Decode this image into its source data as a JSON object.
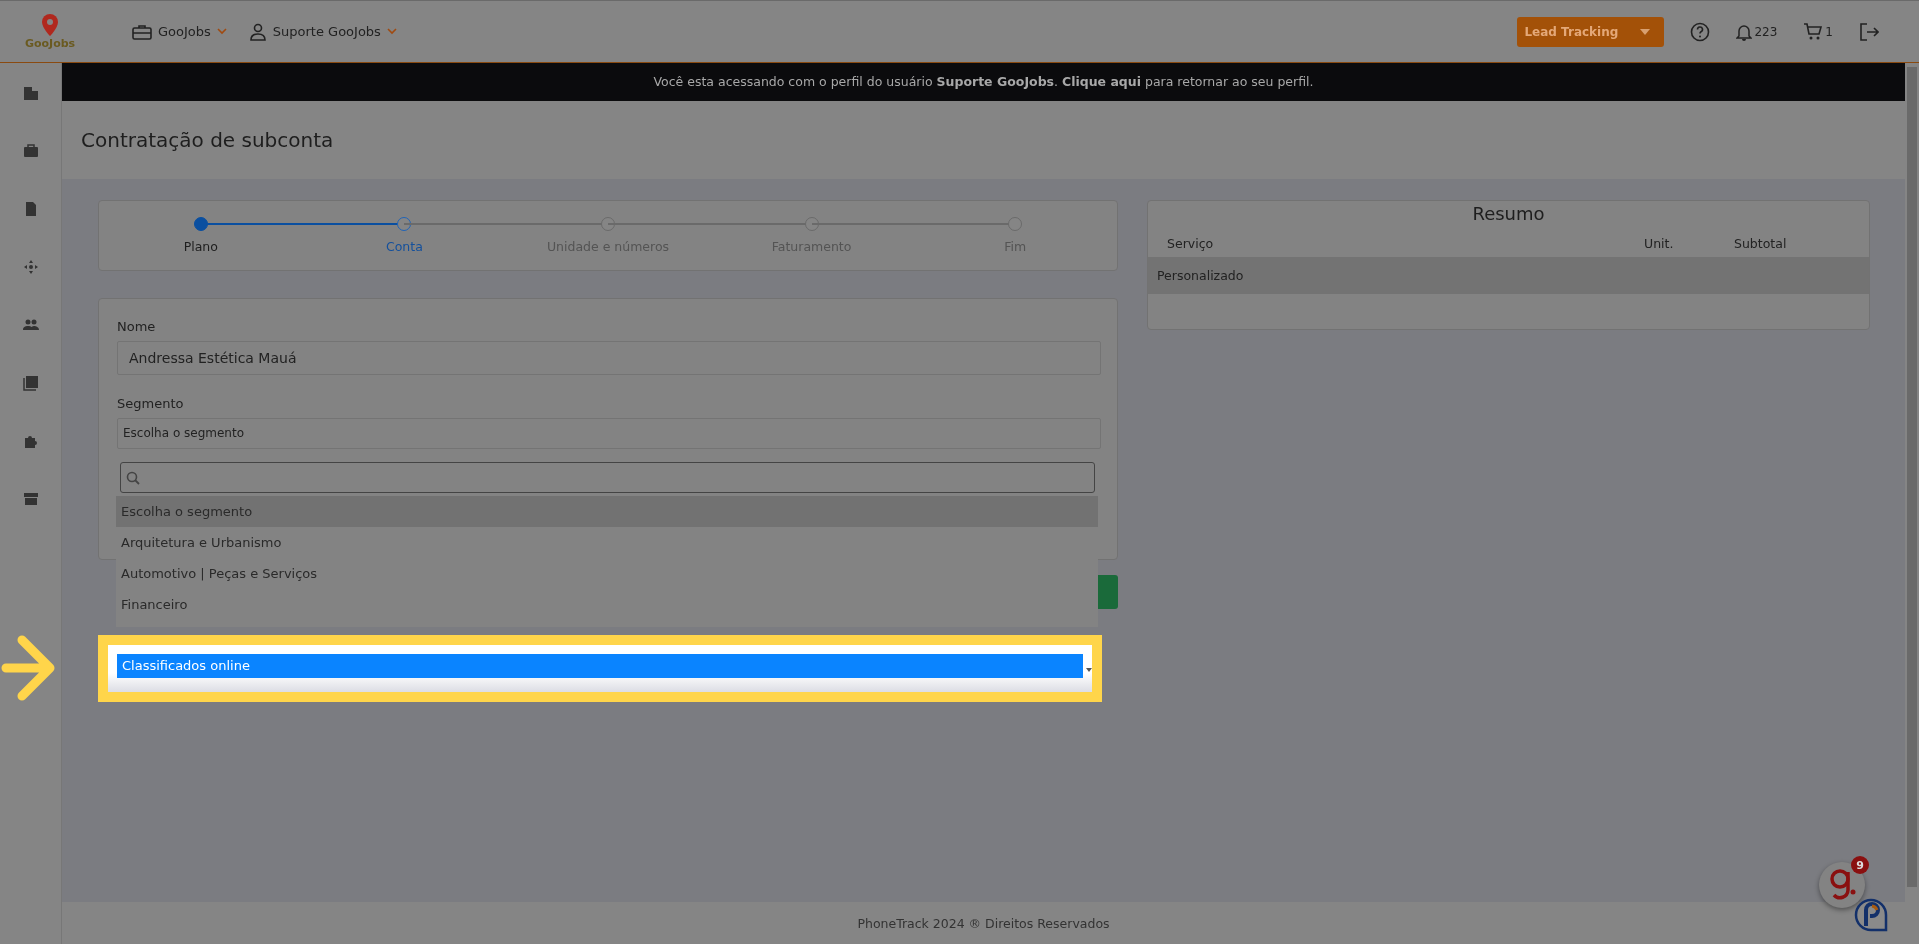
{
  "header": {
    "logo": "GooJobs",
    "menus": [
      {
        "label": "GooJobs"
      },
      {
        "label": "Suporte GooJobs"
      }
    ],
    "lead_button": "Lead Tracking",
    "notifications": "223",
    "cart": "1"
  },
  "banner": {
    "text": "Você esta acessando com o perfil do usuário **Suporte GooJobs**.",
    "link": "Clique aqui",
    "after": "para retornar ao seu perfil."
  },
  "page_title": "Contratação de subconta",
  "steps": [
    {
      "label": "Plano",
      "completed": true,
      "selected": false
    },
    {
      "label": "Conta",
      "completed": false,
      "selected": true
    },
    {
      "label": "Unidade e números",
      "completed": false,
      "selected": false
    },
    {
      "label": "Faturamento",
      "completed": false,
      "selected": false
    },
    {
      "label": "Fim",
      "completed": false,
      "selected": false
    }
  ],
  "form": {
    "name_label": "Nome",
    "name_value": "Andressa Estética Mauá",
    "segment_label": "Segmento",
    "segment_value": "Escolha o segmento"
  },
  "dropdown": {
    "options": [
      {
        "label": "Escolha o segmento",
        "selected": true
      },
      {
        "label": "Arquitetura e Urbanismo",
        "selected": false
      },
      {
        "label": "Automotivo | Peças e Serviços",
        "selected": false
      },
      {
        "label": "Financeiro",
        "selected": false
      }
    ]
  },
  "spotlight": {
    "label": "Classificados online",
    "focused": true
  },
  "summary": {
    "title": "Resumo",
    "columns": [
      "Serviço",
      "Unit.",
      "Subtotal"
    ],
    "rows": [
      {
        "cells": [
          "Personalizado"
        ]
      }
    ]
  },
  "footer": "PhoneTrack 2024 ® Direitos Reservados",
  "chat_badge": "9"
}
